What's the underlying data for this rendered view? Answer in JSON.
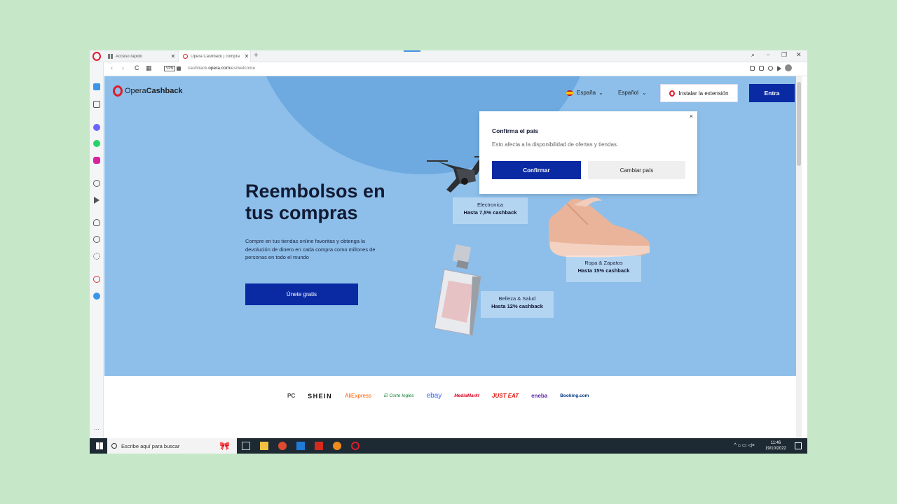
{
  "browser": {
    "tabs": [
      {
        "label": "Acceso rápido"
      },
      {
        "label": "Opera Cashback | compra"
      }
    ],
    "new_tab": "+",
    "close_glyph": "✕",
    "url_prefix": "cashback.",
    "url_domain": "opera.com",
    "url_path": "/es/welcome",
    "vpn_label": "VPN",
    "win_controls": [
      "⌕",
      "⎯",
      "❐",
      "✕"
    ],
    "nav": [
      "‹",
      "›",
      "C",
      "▦"
    ]
  },
  "site": {
    "logo_light": "Opera",
    "logo_bold": "Cashback",
    "country": "España",
    "language": "Español",
    "install_label": "Instalar la extensión",
    "login_label": "Entra",
    "headline": "Reembolsos en tus compras",
    "subtext": "Compre en tus tiendas online favoritas y obtenga la devolución de dinero en cada compra como millones de personas en todo el mundo",
    "cta_label": "Únete gratis"
  },
  "categories": [
    {
      "name": "Electronica",
      "offer": "Hasta 7,5% cashback"
    },
    {
      "name": "Ropa & Zapatos",
      "offer": "Hasta 15% cashback"
    },
    {
      "name": "Belleza & Salud",
      "offer": "Hasta 12% cashback"
    }
  ],
  "dialog": {
    "title": "Confirma el país",
    "description": "Esto afecta a la disponibilidad de ofertas y tiendas.",
    "confirm_label": "Confirmar",
    "change_label": "Cambiar país",
    "close": "×"
  },
  "partners": [
    "PC",
    "SHEIN",
    "AliExpress",
    "El Corte Inglés",
    "ebay",
    "MediaMarkt",
    "JUST EAT",
    "eneba",
    "Booking.com"
  ],
  "taskbar": {
    "search_placeholder": "Escribe aquí para buscar",
    "time": "11:46",
    "date": "19/10/2022",
    "tray": "^ ⌂ ▭ ◁×"
  },
  "colors": {
    "brand_blue": "#0a2aa4",
    "hero": "#8dbfea",
    "opera_red": "#e01c2c"
  }
}
